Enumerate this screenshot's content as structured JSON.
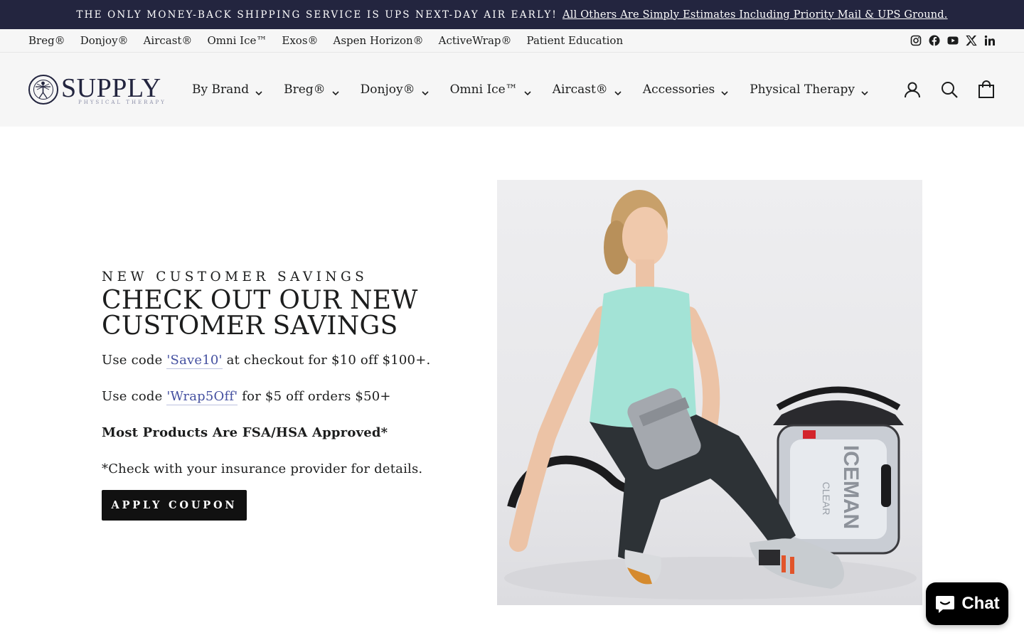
{
  "announcement": {
    "lead": "THE ONLY MONEY-BACK SHIPPING SERVICE IS UPS NEXT-DAY AIR EARLY!",
    "link": "All Others Are Simply Estimates Including Priority Mail & UPS Ground."
  },
  "utility_nav": {
    "links": [
      "Breg®",
      "Donjoy®",
      "Aircast®",
      "Omni Ice™",
      "Exos®",
      "Aspen Horizon®",
      "ActiveWrap®",
      "Patient Education"
    ],
    "social": [
      "instagram-icon",
      "facebook-icon",
      "youtube-icon",
      "x-icon",
      "linkedin-icon"
    ]
  },
  "logo": {
    "wordmark": "SUPPLY",
    "sub": "PHYSICAL THERAPY"
  },
  "main_nav": {
    "items": [
      "By Brand",
      "Breg®",
      "Donjoy®",
      "Omni Ice™",
      "Aircast®",
      "Accessories",
      "Physical Therapy"
    ]
  },
  "header_icons": [
    "account-icon",
    "search-icon",
    "cart-icon"
  ],
  "hero": {
    "eyebrow": "NEW CUSTOMER SAVINGS",
    "headline_line1": "CHECK OUT OUR NEW",
    "headline_line2": "CUSTOMER SAVINGS",
    "p1_before": "Use code ",
    "p1_code": "'Save10'",
    "p1_after": " at checkout for $10 off $100+.",
    "p2_before": "Use code ",
    "p2_code": "'Wrap5Off'",
    "p2_after": " for $5 off orders $50+",
    "p3": "Most Products Are FSA/HSA Approved*",
    "p4": "*Check with your insurance provider for details.",
    "button": "APPLY COUPON",
    "image_product_text": "ICEMAN",
    "image_product_subtext": "CLEAR"
  },
  "chat": {
    "label": "Chat"
  },
  "colors": {
    "announcement_bg": "#23253f",
    "header_bg": "#f6f6f6",
    "link_code": "#4450a0",
    "button_bg": "#111111"
  }
}
